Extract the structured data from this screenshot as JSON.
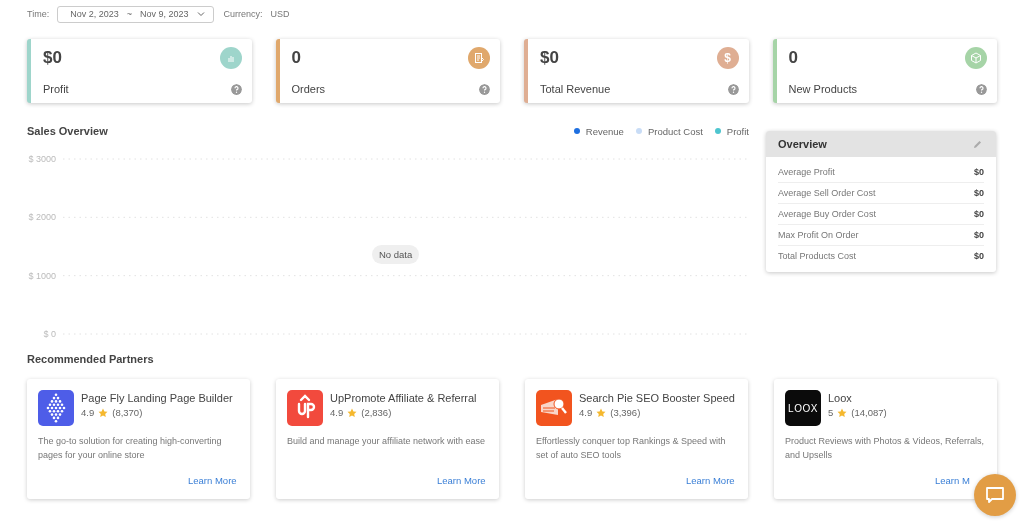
{
  "filter": {
    "time_label": "Time:",
    "date_start": "Nov 2, 2023",
    "date_separator": "~",
    "date_end": "Nov 9, 2023",
    "currency_label": "Currency:",
    "currency": "USD"
  },
  "stats": [
    {
      "value": "$0",
      "label": "Profit",
      "color": "#9ed5cb",
      "kind": "chart"
    },
    {
      "value": "0",
      "label": "Orders",
      "color": "#e0a86c",
      "kind": "document"
    },
    {
      "value": "$0",
      "label": "Total Revenue",
      "color": "#dfae93",
      "kind": "dollar",
      "icon_char": "$"
    },
    {
      "value": "0",
      "label": "New Products",
      "color": "#a6d4a7",
      "kind": "box"
    }
  ],
  "sales_overview": {
    "title": "Sales Overview",
    "no_data": "No data",
    "chart_data": {
      "type": "line",
      "series": [
        {
          "name": "Revenue",
          "color": "#1e6fe0"
        },
        {
          "name": "Product Cost",
          "color": "#c8dcf6"
        },
        {
          "name": "Profit",
          "color": "#4ec5cf"
        }
      ],
      "ylim": [
        0,
        3000
      ],
      "yticks": [
        {
          "value": 0,
          "label": "$ 0"
        },
        {
          "value": 1000,
          "label": "$ 1000"
        },
        {
          "value": 2000,
          "label": "$ 2000"
        },
        {
          "value": 3000,
          "label": "$ 3000"
        }
      ]
    }
  },
  "overview": {
    "title": "Overview",
    "rows": [
      {
        "label": "Average Profit",
        "value": "$0"
      },
      {
        "label": "Average Sell Order Cost",
        "value": "$0"
      },
      {
        "label": "Average Buy Order Cost",
        "value": "$0"
      },
      {
        "label": "Max Profit On Order",
        "value": "$0"
      },
      {
        "label": "Total Products Cost",
        "value": "$0"
      }
    ]
  },
  "partners": {
    "title": "Recommended Partners",
    "items": [
      {
        "name": "Page Fly Landing Page Builder",
        "rating": "4.9",
        "reviews": "(8,370)",
        "description": "The go-to solution for creating high-converting pages for your online store",
        "link": "Learn More",
        "kind": "diamond",
        "color": "#4e5de8"
      },
      {
        "name": "UpPromote Affiliate & Referral",
        "rating": "4.9",
        "reviews": "(2,836)",
        "description": "Build and manage your affiliate network with ease",
        "link": "Learn More",
        "kind": "up",
        "color": "#f24a3d"
      },
      {
        "name": "Search Pie SEO Booster Speed",
        "rating": "4.9",
        "reviews": "(3,396)",
        "description": "Effortlessly conquer top Rankings & Speed with set of auto SEO tools",
        "link": "Learn More",
        "kind": "search",
        "color": "#f2541f"
      },
      {
        "name": "Loox",
        "rating": "5",
        "reviews": "(14,087)",
        "description": "Product Reviews with Photos & Videos, Referrals, and Upsells",
        "link": "Learn M",
        "kind": "text",
        "logo_text": "LOOX",
        "color": "#0b0b0b"
      }
    ]
  }
}
